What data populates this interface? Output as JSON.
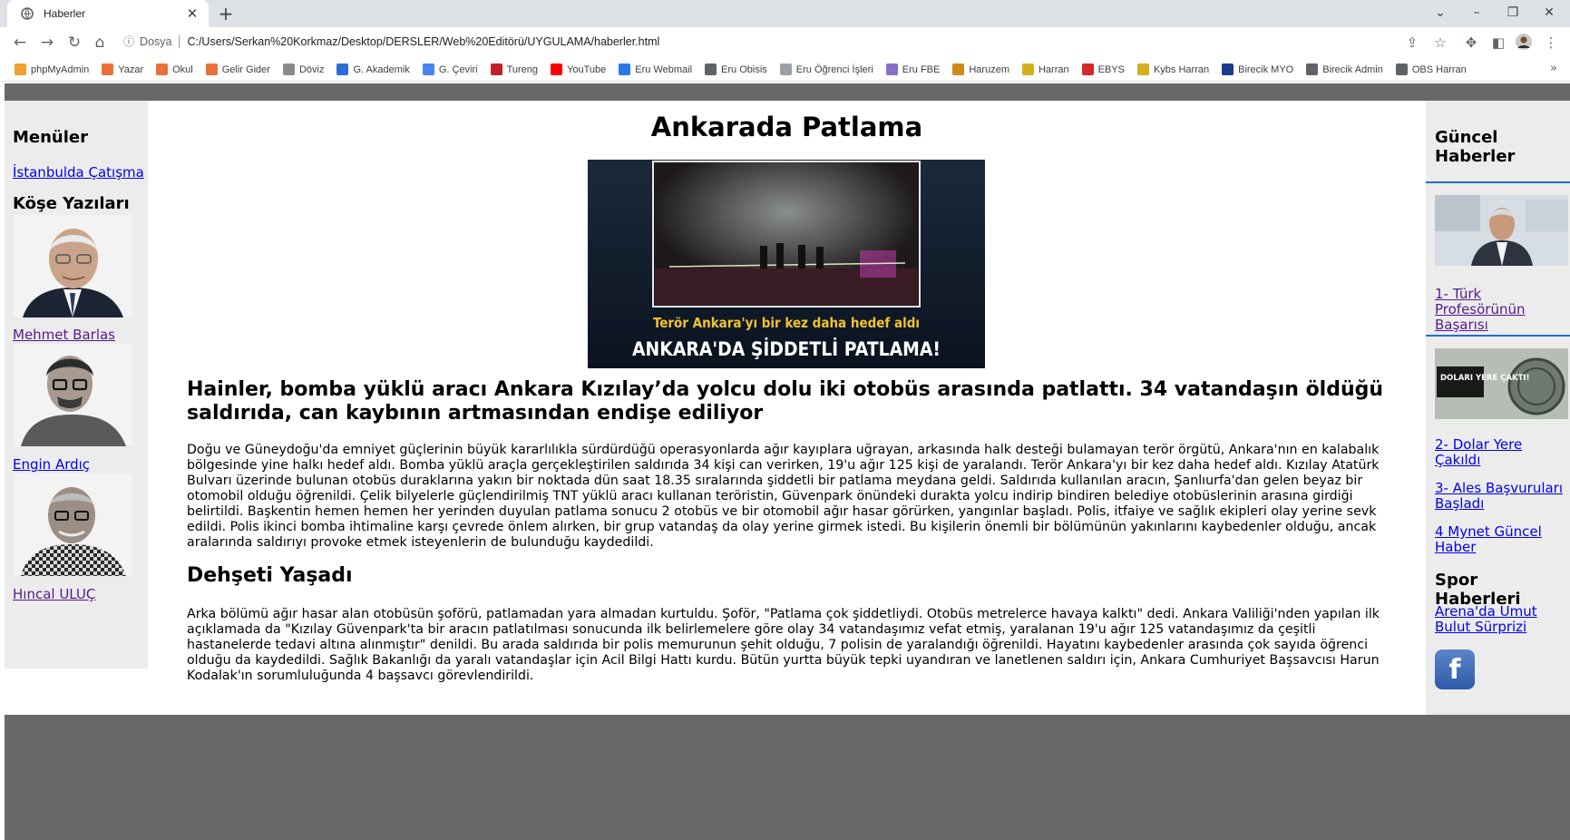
{
  "browser": {
    "tab_title": "Haberler",
    "new_tab": "+",
    "address_prefix": "Dosya",
    "url": "C:/Users/Serkan%20Korkmaz/Desktop/DERSLER/Web%20Editörü/UYGULAMA/haberler.html",
    "bookmarks": [
      {
        "label": "phpMyAdmin",
        "color": "#f0a030"
      },
      {
        "label": "Yazar",
        "color": "#e8703a"
      },
      {
        "label": "Okul",
        "color": "#e8703a"
      },
      {
        "label": "Gelir Gider",
        "color": "#e8703a"
      },
      {
        "label": "Döviz",
        "color": "#8a8a8a"
      },
      {
        "label": "G. Akademik",
        "color": "#2a6dd6"
      },
      {
        "label": "G. Çeviri",
        "color": "#4a84f0"
      },
      {
        "label": "Tureng",
        "color": "#c0202a"
      },
      {
        "label": "YouTube",
        "color": "#ff0000"
      },
      {
        "label": "Eru Webmail",
        "color": "#2b78e4"
      },
      {
        "label": "Eru Obisis",
        "color": "#5f6368"
      },
      {
        "label": "Eru Öğrenci İşleri",
        "color": "#9aa0a6"
      },
      {
        "label": "Eru FBE",
        "color": "#8a6fc9"
      },
      {
        "label": "Haruzem",
        "color": "#d08a1a"
      },
      {
        "label": "Harran",
        "color": "#d4b020"
      },
      {
        "label": "EBYS",
        "color": "#d62828"
      },
      {
        "label": "Kybs Harran",
        "color": "#d4b020"
      },
      {
        "label": "Birecik MYO",
        "color": "#1a3a8a"
      },
      {
        "label": "Birecik Admin",
        "color": "#5f6368"
      },
      {
        "label": "OBS Harran",
        "color": "#5f6368"
      }
    ],
    "more": "»"
  },
  "left": {
    "menu_title": "Menüler",
    "menu_link": "İstanbulda Çatışma",
    "columns_title": "Köşe Yazıları",
    "authors": [
      "Mehmet Barlas",
      "Engin Ardıç",
      "Hıncal ULUÇ"
    ]
  },
  "main": {
    "title": "Ankarada Patlama",
    "image_caption_top": "Terör Ankara'yı bir kez daha hedef aldı",
    "image_caption_bottom": "ANKARA'DA ŞİDDETLİ PATLAMA!",
    "subheading": "Hainler, bomba yüklü aracı  Ankara  Kızılay’da yolcu dolu iki otobüs arasında patlattı. 34 vatandaşın öldüğü saldırıda, can kaybının artmasından endişe ediliyor",
    "paragraph1": "Doğu ve Güneydoğu'da emniyet güçlerinin büyük kararlılıkla sürdürdüğü operasyonlarda ağır kayıplara uğrayan, arkasında halk desteği bulamayan terör örgütü, Ankara'nın en kalabalık bölgesinde yine halkı hedef aldı. Bomba yüklü araçla gerçekleştirilen saldırıda 34 kişi can verirken, 19'u ağır 125 kişi de yaralandı. Terör Ankara'yı bir kez daha hedef aldı. Kızılay Atatürk Bulvarı üzerinde bulunan otobüs duraklarına yakın bir noktada dün saat 18.35 sıralarında şiddetli bir patlama meydana geldi. Saldırıda kullanılan aracın, Şanlıurfa'dan gelen beyaz bir otomobil olduğu öğrenildi. Çelik bilyelerle güçlendirilmiş TNT yüklü aracı kullanan teröristin, Güvenpark önündeki durakta yolcu indirip bindiren belediye otobüslerinin arasına girdiği belirtildi. Başkentin hemen hemen her yerinden duyulan patlama sonucu 2 otobüs ve bir otomobil ağır hasar görürken, yangınlar başladı. Polis, itfaiye ve sağlık ekipleri olay yerine sevk edildi. Polis ikinci bomba ihtimaline karşı çevrede önlem alırken, bir grup vatandaş da olay yerine girmek istedi. Bu kişilerin önemli bir bölümünün yakınlarını kaybedenler olduğu, ancak aralarında saldırıyı provoke etmek isteyenlerin de bulunduğu kaydedildi.",
    "heading2": "Dehşeti Yaşadı",
    "paragraph2": "Arka bölümü ağır hasar alan otobüsün şoförü, patlamadan yara almadan kurtuldu. Şoför, \"Patlama çok şiddetliydi. Otobüs metrelerce havaya kalktı\" dedi. Ankara Valiliği'nden yapılan ilk açıklamada da \"Kızılay Güvenpark'ta bir aracın patlatılması sonucunda ilk belirlemelere göre olay 34 vatandaşımız vefat etmiş, yaralanan 19'u ağır 125 vatandaşımız da çeşitli hastanelerde tedavi altına alınmıştır\" denildi. Bu arada saldırıda bir polis memurunun şehit olduğu, 7 polisin de yaralandığı öğrenildi. Hayatını kaybedenler arasında çok sayıda öğrenci olduğu da kaydedildi. Sağlık Bakanlığı da yaralı vatandaşlar için Acil Bilgi Hattı kurdu. Bütün yurtta büyük tepki uyandıran ve lanetlenen saldırı için, Ankara Cumhuriyet Başsavcısı Harun Kodalak'ın sorumluluğunda 4 başsavcı görevlendirildi."
  },
  "right": {
    "news_title": "Güncel Haberler",
    "news_links": [
      "1- Türk Profesörünün Başarısı",
      "2- Dolar Yere Çakıldı",
      "3- Ales Başvuruları Başladı",
      "4 Mynet Güncel Haber"
    ],
    "thumb2_caption": "DOLARI YERE ÇAKTI!",
    "sports_title": "Spor Haberleri",
    "sports_link": "Arena'da Umut Bulut Sürprizi",
    "fb_letter": "f"
  }
}
